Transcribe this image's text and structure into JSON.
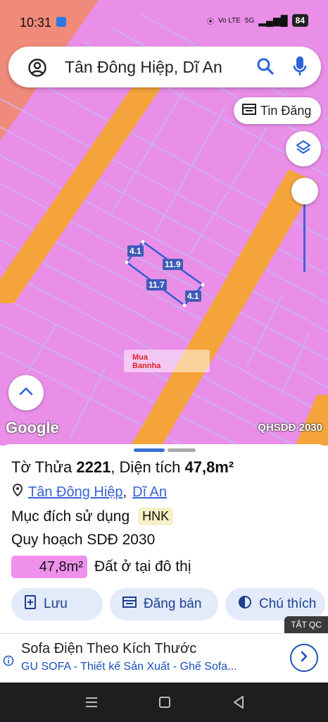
{
  "status": {
    "time": "10:31",
    "network": "5G",
    "volte": "Vo LTE",
    "battery": "84"
  },
  "search": {
    "query": "Tân Đông Hiệp, Dĩ An"
  },
  "map": {
    "tin_dang_label": "Tin Đăng",
    "google_label": "Google",
    "layer_label": "QHSDĐ 2030",
    "dimensions": [
      "4.1",
      "11.9",
      "11.7",
      "4.1"
    ],
    "watermark_lines": [
      "Mua",
      "Bannha"
    ],
    "colors": {
      "land": "#e98fe8",
      "road": "#f4a43b",
      "parcel_line": "#c9a7f0",
      "parcel_outline": "#2f5fd0"
    }
  },
  "sheet": {
    "title_prefix": "Tờ",
    "title_lot": "Thửa",
    "title_lot_no": "2221",
    "title_area_label": ", Diện tích",
    "title_area_value": "47,8m²",
    "location": {
      "ward": "Tân Đông Hiệp",
      "city": "Dĩ An"
    },
    "purpose_label": "Mục đích sử dụng",
    "purpose_code": "HNK",
    "plan_label": "Quy hoạch SDĐ 2030",
    "plan_area": "47,8m²",
    "plan_type": "Đất ở tại đô thị",
    "actions": [
      {
        "icon": "save-icon",
        "label": "Lưu"
      },
      {
        "icon": "listing-icon",
        "label": "Đăng bán"
      },
      {
        "icon": "legend-icon",
        "label": "Chú thích"
      }
    ],
    "ad_close": "TẮT QC",
    "ad": {
      "title": "Sofa Điện Theo Kích Thước",
      "subtitle": "GU SOFA - Thiết kế Sản Xuất - Ghế Sofa..."
    }
  }
}
